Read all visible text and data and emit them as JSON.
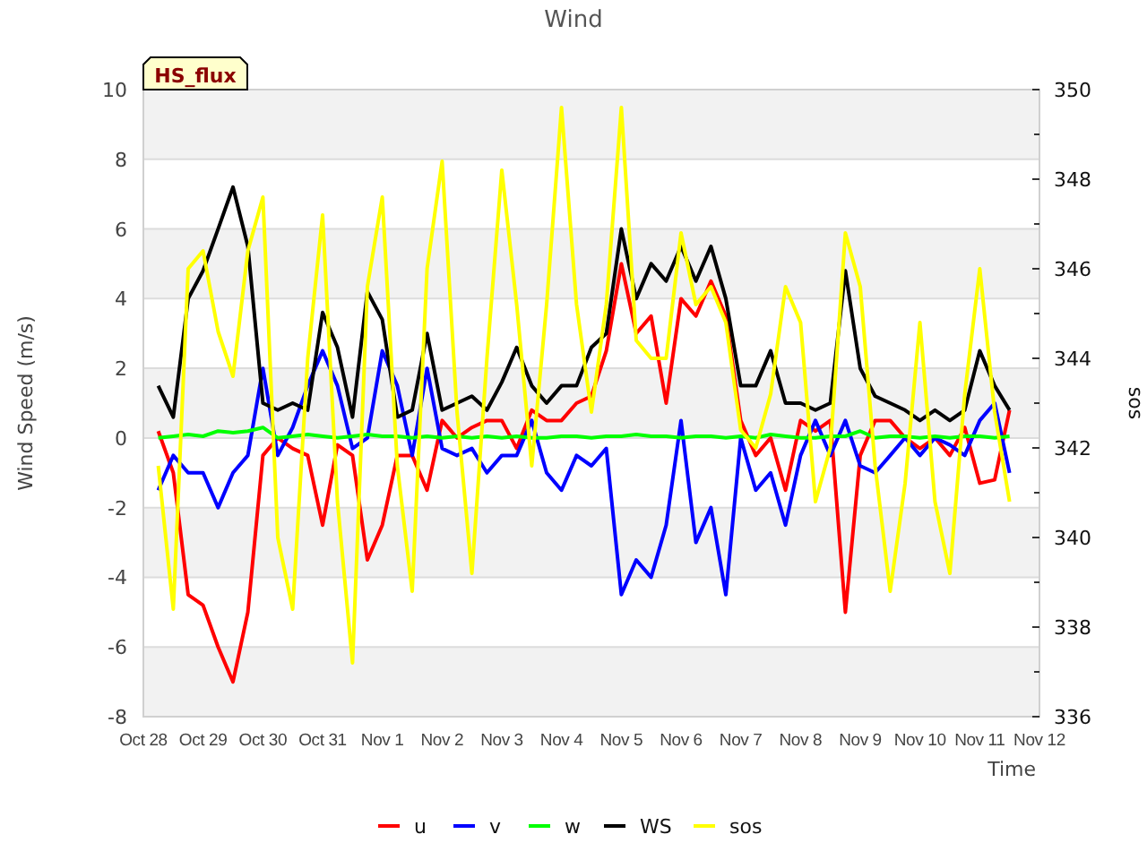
{
  "series_badge": "HS_flux",
  "chart_data": {
    "type": "line",
    "title": "Wind",
    "xlabel": "Time",
    "ylabel": "Wind Speed (m/s)",
    "y2label": "sos",
    "categories": [
      "Oct 28",
      null,
      null,
      null,
      "Oct 29",
      null,
      null,
      null,
      "Oct 30",
      null,
      null,
      null,
      "Oct 31",
      null,
      null,
      null,
      "Nov 1",
      null,
      null,
      null,
      "Nov 2",
      null,
      null,
      null,
      "Nov 3",
      null,
      null,
      null,
      "Nov 4",
      null,
      null,
      null,
      "Nov 5",
      null,
      null,
      null,
      "Nov 6",
      null,
      null,
      null,
      "Nov 7",
      null,
      null,
      null,
      "Nov 8",
      null,
      null,
      null,
      "Nov 9",
      null,
      null,
      null,
      "Nov 10",
      null,
      null,
      null,
      "Nov 11",
      null,
      null,
      null,
      "Nov 12"
    ],
    "grid": true,
    "legend": "bottom",
    "ylim": [
      -8,
      10
    ],
    "y2lim": [
      336,
      350
    ],
    "yticks": [
      -8,
      -6,
      -4,
      -2,
      0,
      2,
      4,
      6,
      8,
      10
    ],
    "y2ticks": [
      336,
      338,
      340,
      342,
      344,
      346,
      348,
      350
    ],
    "series": [
      {
        "name": "u",
        "color": "#ff0000",
        "values": [
          null,
          0.2,
          -1.0,
          -4.5,
          -4.8,
          -6.0,
          -7.0,
          -5.0,
          -0.5,
          0.0,
          -0.3,
          -0.5,
          -2.5,
          -0.2,
          -0.5,
          -3.5,
          -2.5,
          -0.5,
          -0.5,
          -1.5,
          0.5,
          0.0,
          0.3,
          0.5,
          0.5,
          -0.3,
          0.8,
          0.5,
          0.5,
          1.0,
          1.2,
          2.5,
          5.0,
          3.0,
          3.5,
          1.0,
          4.0,
          3.5,
          4.5,
          3.5,
          0.5,
          -0.5,
          0.0,
          -1.5,
          0.5,
          0.2,
          0.5,
          -5.0,
          -0.5,
          0.5,
          0.5,
          0.0,
          -0.3,
          0.0,
          -0.5,
          0.3,
          -1.3,
          -1.2,
          0.8,
          null,
          null
        ]
      },
      {
        "name": "v",
        "color": "#0000ff",
        "values": [
          null,
          -1.5,
          -0.5,
          -1.0,
          -1.0,
          -2.0,
          -1.0,
          -0.5,
          2.0,
          -0.5,
          0.3,
          1.5,
          2.5,
          1.5,
          -0.3,
          0.0,
          2.5,
          1.5,
          -0.5,
          2.0,
          -0.3,
          -0.5,
          -0.3,
          -1.0,
          -0.5,
          -0.5,
          0.5,
          -1.0,
          -1.5,
          -0.5,
          -0.8,
          -0.3,
          -4.5,
          -3.5,
          -4.0,
          -2.5,
          0.5,
          -3.0,
          -2.0,
          -4.5,
          0.0,
          -1.5,
          -1.0,
          -2.5,
          -0.5,
          0.5,
          -0.5,
          0.5,
          -0.8,
          -1.0,
          -0.5,
          0.0,
          -0.5,
          0.0,
          -0.2,
          -0.5,
          0.5,
          1.0,
          -1.0,
          null,
          null
        ]
      },
      {
        "name": "w",
        "color": "#00ff00",
        "values": [
          null,
          0.0,
          0.05,
          0.1,
          0.05,
          0.2,
          0.15,
          0.2,
          0.3,
          0.0,
          0.05,
          0.1,
          0.05,
          0.0,
          0.05,
          0.1,
          0.05,
          0.05,
          0.0,
          0.05,
          0.0,
          0.05,
          0.0,
          0.05,
          0.0,
          0.05,
          0.0,
          0.0,
          0.05,
          0.05,
          0.0,
          0.05,
          0.05,
          0.1,
          0.05,
          0.05,
          0.0,
          0.05,
          0.05,
          0.0,
          0.05,
          0.0,
          0.1,
          0.05,
          0.0,
          0.0,
          0.05,
          0.05,
          0.2,
          0.0,
          0.05,
          0.05,
          0.0,
          0.05,
          0.0,
          0.05,
          0.05,
          0.0,
          0.05,
          null,
          null
        ]
      },
      {
        "name": "WS",
        "color": "#000000",
        "values": [
          null,
          1.5,
          0.6,
          4.0,
          4.8,
          6.0,
          7.2,
          5.5,
          1.0,
          0.8,
          1.0,
          0.8,
          3.6,
          2.6,
          0.6,
          4.2,
          3.4,
          0.6,
          0.8,
          3.0,
          0.8,
          1.0,
          1.2,
          0.8,
          1.6,
          2.6,
          1.5,
          1.0,
          1.5,
          1.5,
          2.6,
          3.0,
          6.0,
          4.0,
          5.0,
          4.5,
          5.5,
          4.5,
          5.5,
          4.0,
          1.5,
          1.5,
          2.5,
          1.0,
          1.0,
          0.8,
          1.0,
          4.8,
          2.0,
          1.2,
          1.0,
          0.8,
          0.5,
          0.8,
          0.5,
          0.8,
          2.5,
          1.5,
          0.8,
          null,
          null
        ]
      },
      {
        "name": "sos",
        "color": "#ffff00",
        "axis": "y2",
        "values": [
          null,
          341.6,
          338.4,
          346.0,
          346.4,
          344.6,
          343.6,
          346.4,
          347.6,
          340.0,
          338.4,
          344.0,
          347.2,
          340.8,
          337.2,
          345.6,
          347.6,
          341.6,
          338.8,
          346.0,
          348.4,
          342.8,
          339.2,
          344.0,
          348.2,
          345.2,
          341.6,
          345.2,
          349.6,
          345.2,
          342.8,
          345.2,
          349.6,
          344.4,
          344.0,
          344.0,
          346.8,
          345.2,
          345.6,
          344.8,
          342.4,
          342.0,
          343.2,
          345.6,
          344.8,
          340.8,
          342.0,
          346.8,
          345.6,
          341.6,
          338.8,
          341.2,
          344.8,
          340.8,
          339.2,
          343.2,
          346.0,
          342.8,
          340.8,
          null,
          null
        ]
      }
    ]
  }
}
